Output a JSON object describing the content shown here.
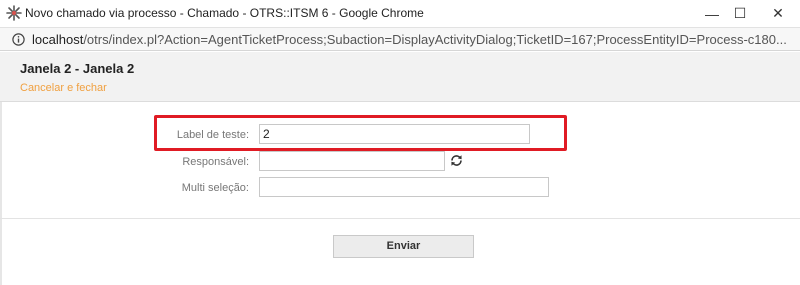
{
  "window": {
    "title": "Novo chamado via processo - Chamado - OTRS::ITSM 6 - Google Chrome",
    "minimize_glyph": "—",
    "maximize_glyph": "☐",
    "close_glyph": "✕"
  },
  "address_bar": {
    "host": "localhost",
    "path": "/otrs/index.pl?Action=AgentTicketProcess;Subaction=DisplayActivityDialog;TicketID=167;ProcessEntityID=Process-c180..."
  },
  "dialog": {
    "title": "Janela 2 - Janela 2",
    "cancel_link": "Cancelar e fechar"
  },
  "form": {
    "fields": [
      {
        "label": "Label de teste:",
        "value": "2"
      },
      {
        "label": "Responsável:",
        "value": ""
      },
      {
        "label": "Multi seleção:",
        "value": ""
      }
    ],
    "submit_label": "Enviar"
  },
  "icons": {
    "app": "otrs-star-icon",
    "info": "info-icon",
    "refresh": "refresh-icon"
  },
  "colors": {
    "highlight": "#e01b24",
    "cancel_link": "#f0a040"
  }
}
